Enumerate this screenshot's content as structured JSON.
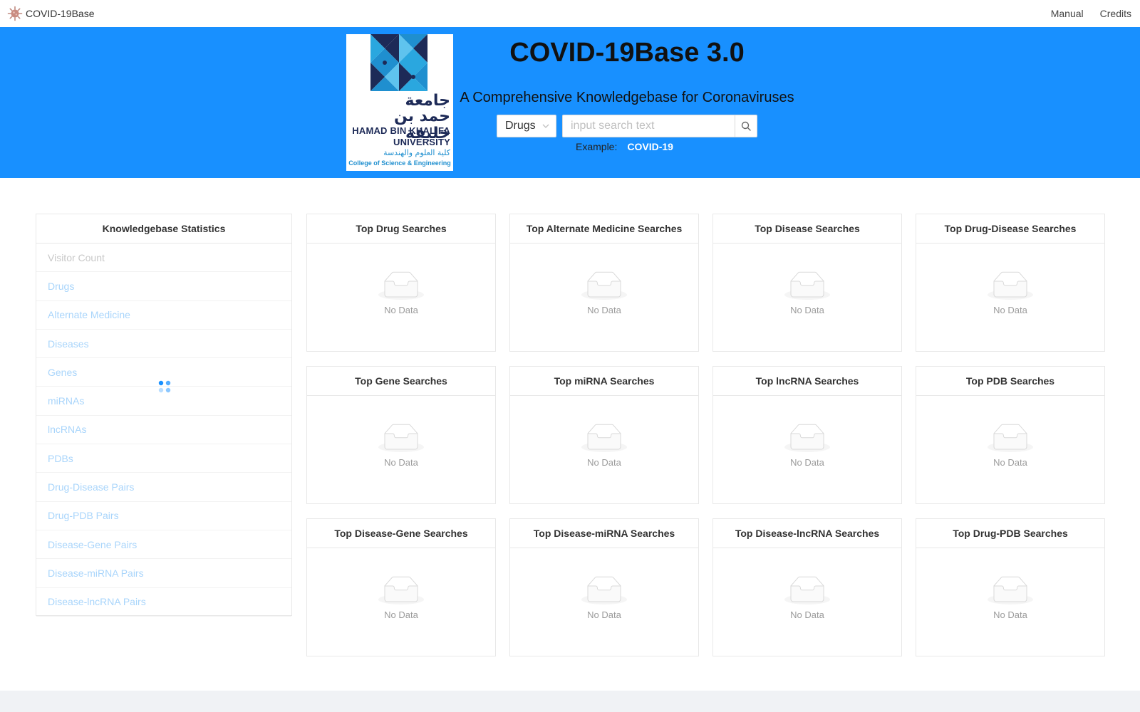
{
  "nav": {
    "brand": "COVID-19Base",
    "links": [
      "Manual",
      "Credits"
    ]
  },
  "hero": {
    "title": "COVID-19Base 3.0",
    "subtitle": "A Comprehensive Knowledgebase for Coronaviruses",
    "select_value": "Drugs",
    "search_placeholder": "input search text",
    "example_label": "Example:",
    "example_value": "COVID-19",
    "logo": {
      "arabic_1": "جامعة",
      "arabic_2": "حمد بن خليفة",
      "en_1": "HAMAD BIN KHALIFA",
      "en_2": "UNIVERSITY",
      "college_ar": "كلية العلوم والهندسة",
      "college_en": "College of Science & Engineering"
    }
  },
  "stats": {
    "title": "Knowledgebase Statistics",
    "items": [
      "Visitor Count",
      "Drugs",
      "Alternate Medicine",
      "Diseases",
      "Genes",
      "miRNAs",
      "lncRNAs",
      "PDBs",
      "Drug-Disease Pairs",
      "Drug-PDB Pairs",
      "Disease-Gene Pairs",
      "Disease-miRNA Pairs",
      "Disease-lncRNA Pairs"
    ]
  },
  "empty_text": "No Data",
  "cards": [
    "Top Drug Searches",
    "Top Alternate Medicine Searches",
    "Top Disease Searches",
    "Top Drug-Disease Searches",
    "Top Gene Searches",
    "Top miRNA Searches",
    "Top lncRNA Searches",
    "Top PDB Searches",
    "Top Disease-Gene Searches",
    "Top Disease-miRNA Searches",
    "Top Disease-lncRNA Searches",
    "Top Drug-PDB Searches"
  ],
  "colors": {
    "primary": "#1890ff",
    "link_faded": "#a9d5fb",
    "logo_navy": "#1d2a57",
    "logo_blue": "#1f8fcf"
  },
  "icons": {
    "brand": "virus-icon",
    "select": "chevron-down-icon",
    "search": "search-icon",
    "empty": "empty-inbox-icon",
    "loading": "loading-spinner-icon"
  }
}
